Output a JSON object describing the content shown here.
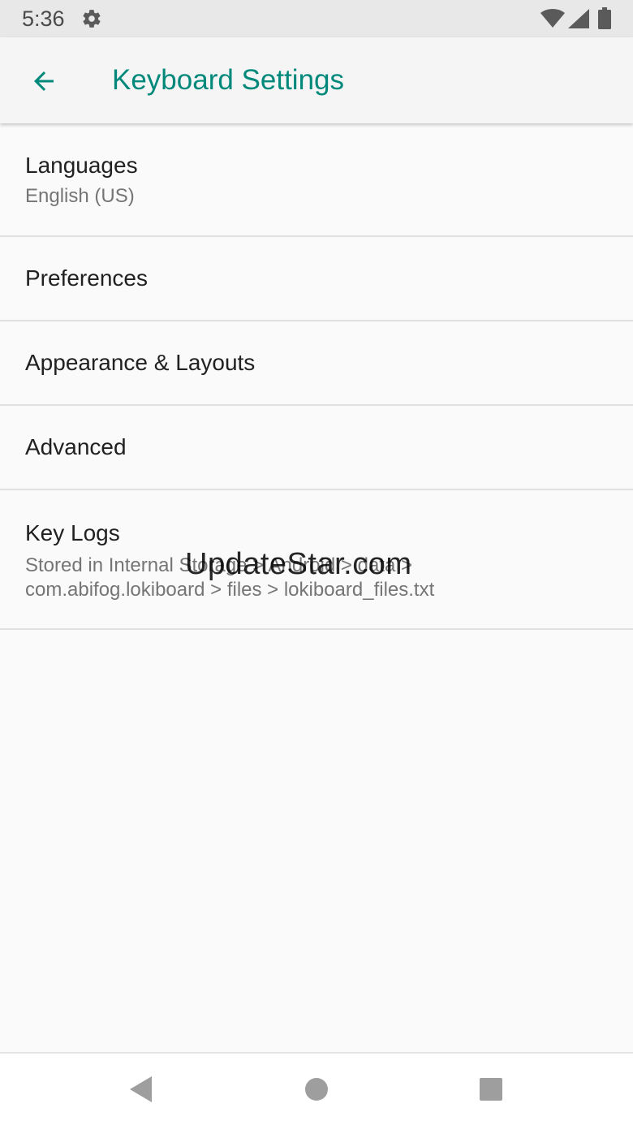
{
  "status_bar": {
    "time": "5:36",
    "icons": [
      "settings-gear-icon",
      "wifi-icon",
      "cell-signal-icon",
      "battery-icon"
    ]
  },
  "app_bar": {
    "back_icon": "arrow-back-icon",
    "title": "Keyboard Settings"
  },
  "colors": {
    "accent": "#00897b",
    "status_bar_bg": "#e8e8e8",
    "app_bar_bg": "#f5f5f5",
    "background": "#fafafa",
    "divider": "#e0e0e0",
    "title_text": "#212121",
    "summary_text": "#757575",
    "nav_icon": "#9e9e9e"
  },
  "settings": {
    "languages": {
      "title": "Languages",
      "summary": "English (US)"
    },
    "preferences": {
      "title": "Preferences"
    },
    "appearance": {
      "title": "Appearance & Layouts"
    },
    "advanced": {
      "title": "Advanced"
    },
    "key_logs": {
      "title": "Key Logs",
      "summary_line1": "Stored in Internal Storage > Android > data >",
      "summary_line2": "com.abifog.lokiboard > files > lokiboard_files.txt"
    }
  },
  "watermark": "UpdateStar.com",
  "nav_bar": {
    "icons": [
      "nav-back-icon",
      "nav-home-icon",
      "nav-recents-icon"
    ]
  }
}
